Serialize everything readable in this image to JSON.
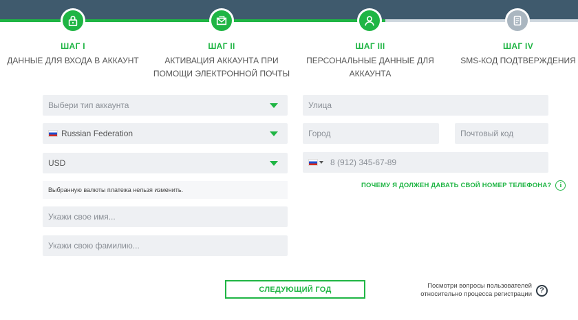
{
  "steps": [
    {
      "title": "ШАГ I",
      "desc": "ДАННЫЕ ДЛЯ ВХОДА В АККАУНТ",
      "icon": "lock-icon",
      "state": "done"
    },
    {
      "title": "ШАГ II",
      "desc": "АКТИВАЦИЯ АККАУНТА ПРИ ПОМОЩИ ЭЛЕКТРОННОЙ ПОЧТЫ",
      "icon": "envelope-icon",
      "state": "done"
    },
    {
      "title": "ШАГ III",
      "desc": "ПЕРСОНАЛЬНЫЕ ДАННЫЕ ДЛЯ АККАУНТА",
      "icon": "user-icon",
      "state": "done"
    },
    {
      "title": "ШАГ IV",
      "desc": "SMS-КОД ПОДТВЕРЖДЕНИЯ",
      "icon": "sms-icon",
      "state": "pending"
    }
  ],
  "form": {
    "account_type_placeholder": "Выбери тип аккаунта",
    "country_value": "Russian Federation",
    "currency_value": "USD",
    "currency_note": "Выбранную валюты платежа нельзя изменить.",
    "first_name_placeholder": "Укажи свое имя...",
    "last_name_placeholder": "Укажи свою фамилию...",
    "street_placeholder": "Улица",
    "city_placeholder": "Город",
    "postal_placeholder": "Почтовый код",
    "phone_placeholder": "8 (912) 345-67-89",
    "why_phone_label": "ПОЧЕМУ Я ДОЛЖЕН ДАВАТЬ СВОЙ НОМЕР ТЕЛЕФОНА?"
  },
  "next_button_label": "СЛЕДУЮЩИЙ ГОД",
  "faq": {
    "line1": "Посмотри вопросы пользователей",
    "line2": "относительно процесса регистрации"
  },
  "colors": {
    "accent": "#1fb544",
    "header_band": "#3f5a6d",
    "field_bg": "#eef0f3",
    "pending_step": "#aab6c0"
  }
}
